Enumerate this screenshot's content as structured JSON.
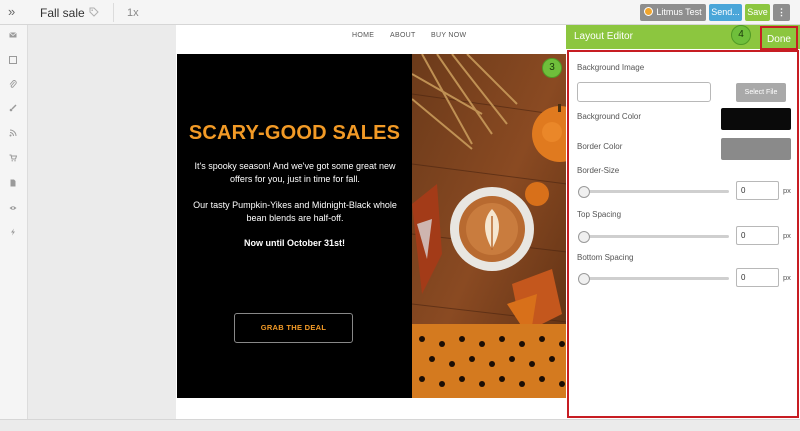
{
  "header": {
    "title": "Fall sale",
    "zoom": "1x",
    "litmus_label": "Litmus Test",
    "send_label": "Send...",
    "save_label": "Save",
    "more_label": "⋮"
  },
  "email": {
    "nav": [
      "HOME",
      "ABOUT",
      "BUY NOW"
    ],
    "headline": "SCARY-GOOD SALES",
    "paragraph1": "It's spooky season! And we've got some great new offers for you, just in time for fall.",
    "paragraph2": "Our tasty Pumpkin-Yikes and Midnight-Black whole bean blends are half-off.",
    "deadline": "Now until October 31st!",
    "cta": "GRAB THE DEAL"
  },
  "editor": {
    "title": "Layout Editor",
    "done_label": "Done",
    "background_image_label": "Background Image",
    "background_image_value": "",
    "select_file_label": "Select File",
    "background_color_label": "Background Color",
    "background_color_value": "#0a0a0a",
    "border_color_label": "Border Color",
    "border_color_value": "#8a8a8a",
    "border_size_label": "Border-Size",
    "border_size_value": "0",
    "top_spacing_label": "Top Spacing",
    "top_spacing_value": "0",
    "bottom_spacing_label": "Bottom Spacing",
    "bottom_spacing_value": "0",
    "unit": "px"
  },
  "badges": {
    "three": "3",
    "four": "4"
  },
  "colors": {
    "accent_green": "#8cc63f",
    "send_blue": "#4aa6d9",
    "highlight_red": "#c71d23",
    "headline_orange": "#f29a26"
  }
}
